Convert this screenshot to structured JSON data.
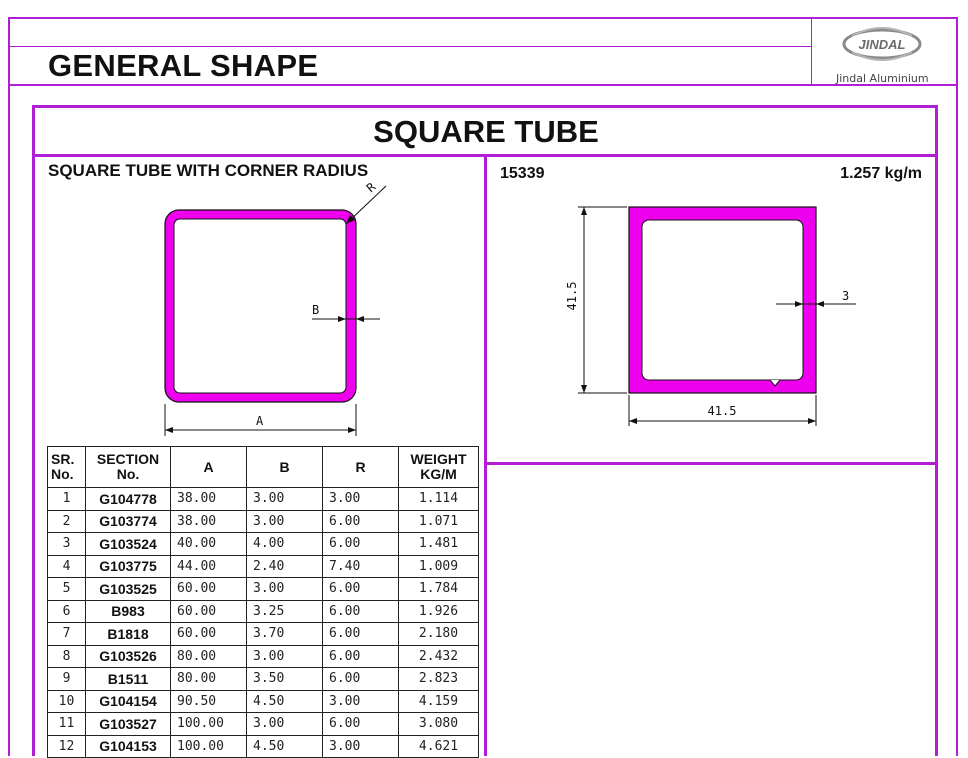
{
  "header": {
    "title": "GENERAL SHAPE"
  },
  "logo": {
    "emblem_text": "JINDAL",
    "brand_text": "Jindal Aluminium"
  },
  "section": {
    "banner": "SQUARE TUBE"
  },
  "left_panel": {
    "subtitle": "SQUARE TUBE WITH CORNER RADIUS",
    "dims": {
      "a": "A",
      "b": "B",
      "r": "R"
    }
  },
  "right_panel": {
    "code": "15339",
    "weight": "1.257 kg/m",
    "dims": {
      "height": "41.5",
      "width": "41.5",
      "thickness": "3"
    }
  },
  "table": {
    "headers": {
      "sr": [
        "SR.",
        "No."
      ],
      "section": [
        "SECTION",
        "No."
      ],
      "a": "A",
      "b": "B",
      "r": "R",
      "weight": [
        "WEIGHT",
        "KG/M"
      ]
    },
    "rows": [
      {
        "sr": "1",
        "section": "G104778",
        "a": "38.00",
        "b": "3.00",
        "r": "3.00",
        "w": "1.114"
      },
      {
        "sr": "2",
        "section": "G103774",
        "a": "38.00",
        "b": "3.00",
        "r": "6.00",
        "w": "1.071"
      },
      {
        "sr": "3",
        "section": "G103524",
        "a": "40.00",
        "b": "4.00",
        "r": "6.00",
        "w": "1.481"
      },
      {
        "sr": "4",
        "section": "G103775",
        "a": "44.00",
        "b": "2.40",
        "r": "7.40",
        "w": "1.009"
      },
      {
        "sr": "5",
        "section": "G103525",
        "a": "60.00",
        "b": "3.00",
        "r": "6.00",
        "w": "1.784"
      },
      {
        "sr": "6",
        "section": "B983",
        "a": "60.00",
        "b": "3.25",
        "r": "6.00",
        "w": "1.926"
      },
      {
        "sr": "7",
        "section": "B1818",
        "a": "60.00",
        "b": "3.70",
        "r": "6.00",
        "w": "2.180"
      },
      {
        "sr": "8",
        "section": "G103526",
        "a": "80.00",
        "b": "3.00",
        "r": "6.00",
        "w": "2.432"
      },
      {
        "sr": "9",
        "section": "B1511",
        "a": "80.00",
        "b": "3.50",
        "r": "6.00",
        "w": "2.823"
      },
      {
        "sr": "10",
        "section": "G104154",
        "a": "90.50",
        "b": "4.50",
        "r": "3.00",
        "w": "4.159"
      },
      {
        "sr": "11",
        "section": "G103527",
        "a": "100.00",
        "b": "3.00",
        "r": "6.00",
        "w": "3.080"
      },
      {
        "sr": "12",
        "section": "G104153",
        "a": "100.00",
        "b": "4.50",
        "r": "3.00",
        "w": "4.621"
      }
    ]
  },
  "colors": {
    "border": "#b01ed6",
    "profile": "#ee00ee"
  }
}
